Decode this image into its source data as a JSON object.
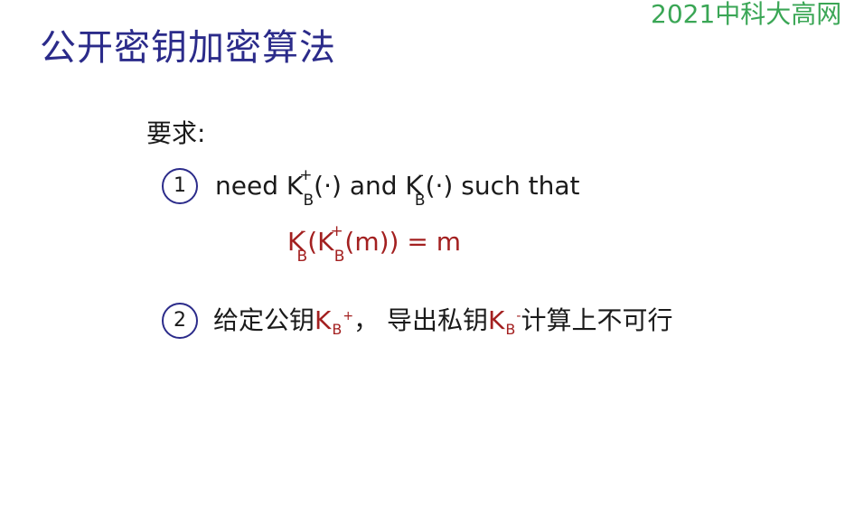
{
  "watermark": "2021中科大高网",
  "title": "公开密钥加密算法",
  "requirement_label": "要求:",
  "items": [
    {
      "number": "1",
      "prefix": "need ",
      "key_letter": "K",
      "key_sub": "B",
      "key_public_sup": "+",
      "key_private_sup": "-",
      "dot_arg": "(·)",
      "middle": " and ",
      "suffix": " such that"
    },
    {
      "number": "2",
      "text_a": "给定公钥",
      "text_b": "，  导出私钥",
      "text_c": "计算上不可行"
    }
  ],
  "formula": {
    "k_letter": "K",
    "k_sub": "B",
    "private_sup": "-",
    "public_sup": "+",
    "open": "(",
    "m_arg": "(m))",
    "equals": "  =  m"
  }
}
